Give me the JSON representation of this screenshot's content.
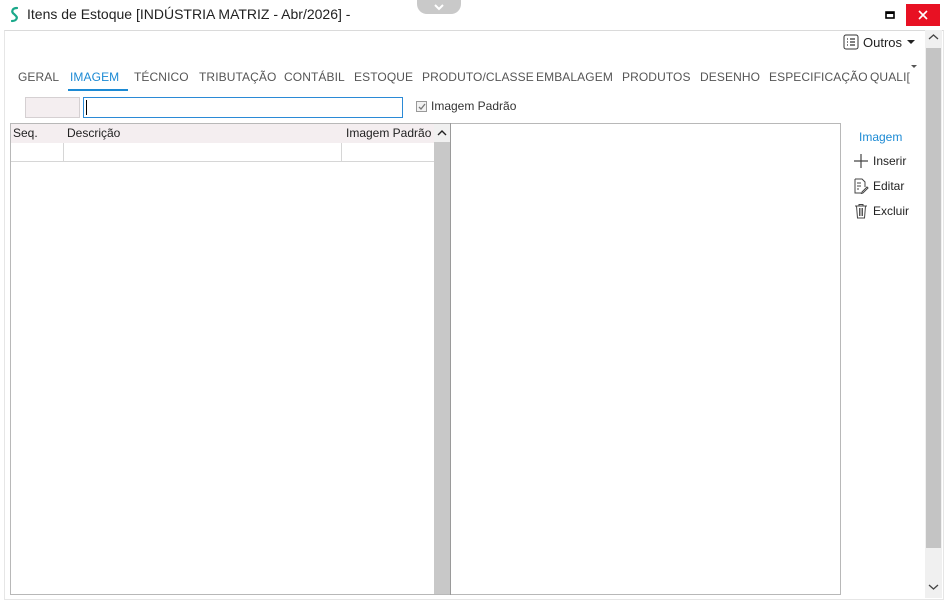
{
  "window": {
    "title": "Itens de Estoque [INDÚSTRIA MATRIZ - Abr/2026]  -"
  },
  "toolbar": {
    "outros_label": "Outros"
  },
  "tabs": [
    {
      "label": "GERAL"
    },
    {
      "label": "IMAGEM"
    },
    {
      "label": "TÉCNICO"
    },
    {
      "label": "TRIBUTAÇÃO"
    },
    {
      "label": "CONTÁBIL"
    },
    {
      "label": "ESTOQUE"
    },
    {
      "label": "PRODUTO/CLASSE"
    },
    {
      "label": "EMBALAGEM"
    },
    {
      "label": "PRODUTOS"
    },
    {
      "label": "DESENHO"
    },
    {
      "label": "ESPECIFICAÇÃO"
    },
    {
      "label": "QUALI["
    }
  ],
  "active_tab": "IMAGEM",
  "form": {
    "seq_value": "",
    "description_value": "",
    "default_image_label": "Imagem Padrão",
    "default_image_checked": true
  },
  "grid": {
    "columns": [
      "Seq.",
      "Descrição",
      "Imagem Padrão"
    ],
    "rows": [
      [
        "",
        "",
        ""
      ]
    ]
  },
  "side_panel": {
    "title": "Imagem",
    "actions": [
      {
        "label": "Inserir",
        "icon": "plus-icon"
      },
      {
        "label": "Editar",
        "icon": "edit-document-icon"
      },
      {
        "label": "Excluir",
        "icon": "trash-icon"
      }
    ]
  },
  "colors": {
    "accent": "#1c8ad4",
    "close_button": "#e81123",
    "header_bg": "#f4eef0",
    "logo": "#1aa88a"
  }
}
